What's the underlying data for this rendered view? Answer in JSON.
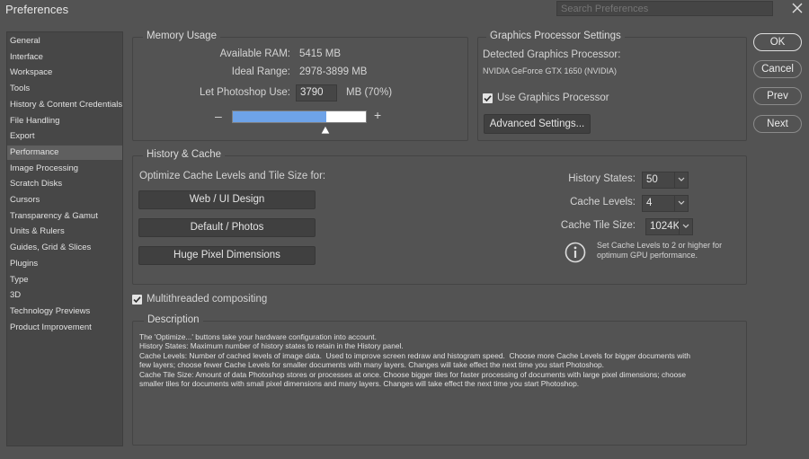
{
  "window": {
    "title": "Preferences",
    "search_placeholder": "Search Preferences"
  },
  "sidebar": {
    "items": [
      {
        "label": "General"
      },
      {
        "label": "Interface"
      },
      {
        "label": "Workspace"
      },
      {
        "label": "Tools"
      },
      {
        "label": "History & Content Credentials"
      },
      {
        "label": "File Handling"
      },
      {
        "label": "Export"
      },
      {
        "label": "Performance",
        "selected": true
      },
      {
        "label": "Image Processing"
      },
      {
        "label": "Scratch Disks"
      },
      {
        "label": "Cursors"
      },
      {
        "label": "Transparency & Gamut"
      },
      {
        "label": "Units & Rulers"
      },
      {
        "label": "Guides, Grid & Slices"
      },
      {
        "label": "Plugins"
      },
      {
        "label": "Type"
      },
      {
        "label": "3D"
      },
      {
        "label": "Technology Previews"
      },
      {
        "label": "Product Improvement"
      }
    ]
  },
  "memory": {
    "title": "Memory Usage",
    "available_label": "Available RAM:",
    "available_value": "5415 MB",
    "ideal_label": "Ideal Range:",
    "ideal_value": "2978-3899 MB",
    "let_label": "Let Photoshop Use:",
    "let_value": "3790",
    "let_unit": "MB (70%)",
    "minus": "–",
    "plus": "+",
    "slider_fraction": 0.7
  },
  "gpu": {
    "title": "Graphics Processor Settings",
    "detected_label": "Detected Graphics Processor:",
    "detected_value": "NVIDIA GeForce GTX 1650 (NVIDIA)",
    "use_label": "Use Graphics Processor",
    "use_checked": true,
    "advanced_label": "Advanced Settings..."
  },
  "buttons": {
    "ok": "OK",
    "cancel": "Cancel",
    "prev": "Prev",
    "next": "Next"
  },
  "history_cache": {
    "title": "History & Cache",
    "optimize_label": "Optimize Cache Levels and Tile Size for:",
    "web_button": "Web / UI Design",
    "default_button": "Default / Photos",
    "huge_button": "Huge Pixel Dimensions",
    "history_states_label": "History States:",
    "history_states_value": "50",
    "cache_levels_label": "Cache Levels:",
    "cache_levels_value": "4",
    "cache_tile_label": "Cache Tile Size:",
    "cache_tile_value": "1024K",
    "info_text": "Set Cache Levels to 2 or higher for optimum GPU performance."
  },
  "multithreaded": {
    "label": "Multithreaded compositing",
    "checked": true
  },
  "description": {
    "title": "Description",
    "text": "The 'Optimize...' buttons take your hardware configuration into account.\nHistory States: Maximum number of history states to retain in the History panel.\nCache Levels: Number of cached levels of image data.  Used to improve screen redraw and histogram speed.  Choose more Cache Levels for bigger documents with\nfew layers; choose fewer Cache Levels for smaller documents with many layers. Changes will take effect the next time you start Photoshop.\nCache Tile Size: Amount of data Photoshop stores or processes at once. Choose bigger tiles for faster processing of documents with large pixel dimensions; choose\nsmaller tiles for documents with small pixel dimensions and many layers. Changes will take effect the next time you start Photoshop."
  },
  "icons": {
    "close": "close-icon",
    "info": "info-icon",
    "check": "check-icon",
    "dropdown": "chevron-down-icon",
    "slider_thumb": "slider-thumb-icon"
  }
}
